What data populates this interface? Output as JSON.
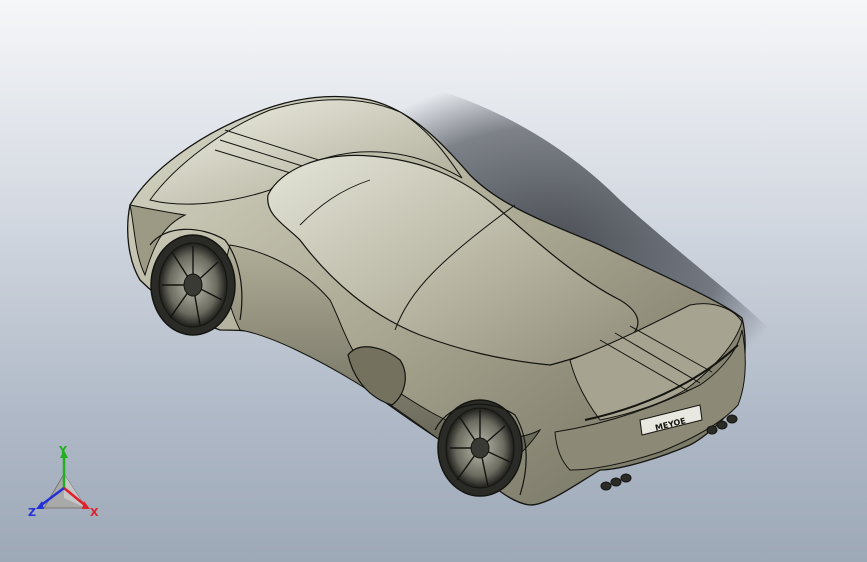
{
  "viewport": {
    "plate_text": "MEYOE"
  },
  "triad": {
    "x_label": "X",
    "y_label": "Y",
    "z_label": "Z",
    "colors": {
      "x": "#e0202a",
      "y": "#22b020",
      "z": "#2430d8"
    }
  }
}
